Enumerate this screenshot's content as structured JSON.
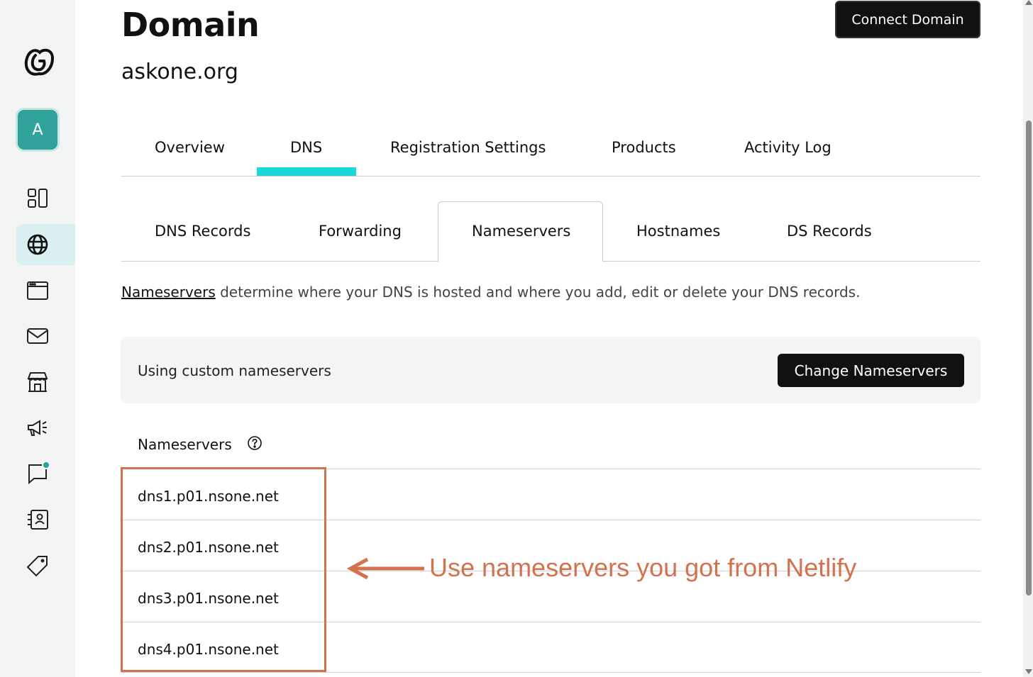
{
  "sidebar": {
    "logo": "godaddy-logo-icon",
    "avatar_letter": "A",
    "items": [
      {
        "icon": "dashboard-icon"
      },
      {
        "icon": "globe-icon",
        "active": true
      },
      {
        "icon": "browser-window-icon"
      },
      {
        "icon": "mail-icon"
      },
      {
        "icon": "store-icon"
      },
      {
        "icon": "megaphone-icon"
      },
      {
        "icon": "chat-icon",
        "notification": true
      },
      {
        "icon": "contacts-icon"
      },
      {
        "icon": "tag-icon"
      }
    ]
  },
  "header": {
    "title": "Domain",
    "domain": "askone.org",
    "connect_label": "Connect Domain"
  },
  "tabs": [
    {
      "label": "Overview"
    },
    {
      "label": "DNS",
      "active": true
    },
    {
      "label": "Registration Settings"
    },
    {
      "label": "Products"
    },
    {
      "label": "Activity Log"
    }
  ],
  "subtabs": [
    {
      "label": "DNS Records"
    },
    {
      "label": "Forwarding"
    },
    {
      "label": "Nameservers",
      "active": true
    },
    {
      "label": "Hostnames"
    },
    {
      "label": "DS Records"
    }
  ],
  "description": {
    "link": "Nameservers",
    "text": " determine where your DNS is hosted and where you add, edit or delete your DNS records."
  },
  "status": {
    "text": "Using custom nameservers",
    "button": "Change Nameservers"
  },
  "nameservers": {
    "header": "Nameservers",
    "values": [
      "dns1.p01.nsone.net",
      "dns2.p01.nsone.net",
      "dns3.p01.nsone.net",
      "dns4.p01.nsone.net"
    ]
  },
  "annotation": {
    "text": "Use nameservers you got from Netlify",
    "color": "#d4714e"
  },
  "colors": {
    "accent": "#1bd6d9",
    "avatar": "#2fa39a",
    "button": "#111111"
  }
}
